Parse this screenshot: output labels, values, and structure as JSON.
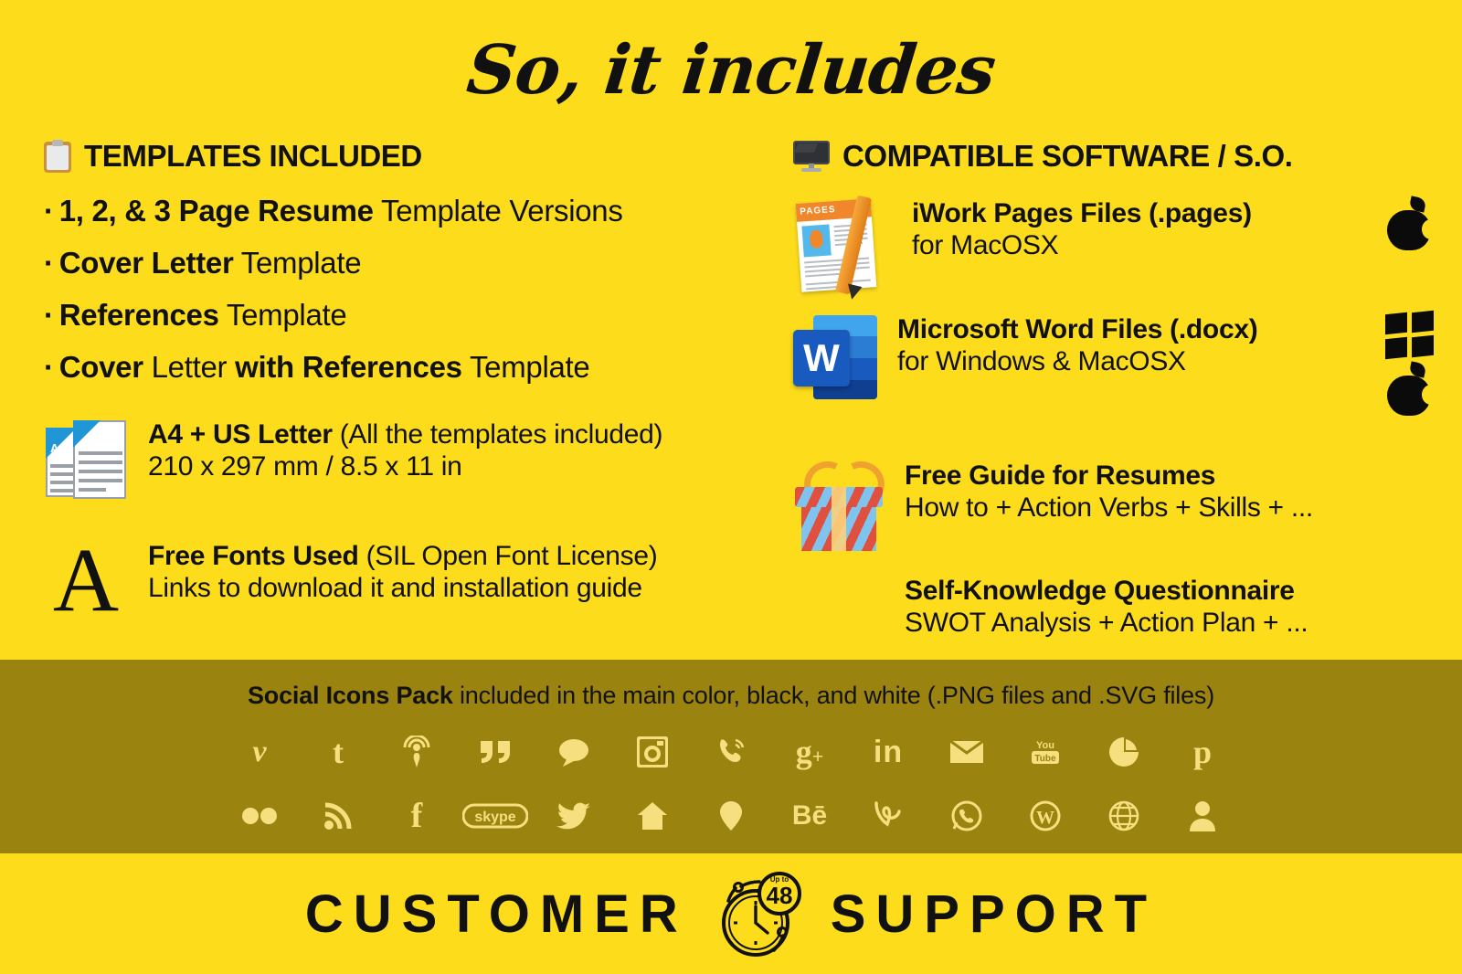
{
  "colors": {
    "background": "#FDDC1C",
    "band": "#9B830F",
    "icon_tint": "#F6DF7E",
    "text": "#111111",
    "word_blue": "#185ABD",
    "pages_orange": "#F0872A"
  },
  "title": "So, it includes",
  "left": {
    "heading": {
      "icon": "clipboard-icon",
      "label": "TEMPLATES INCLUDED"
    },
    "bullets": [
      {
        "marker": "·",
        "bold1": "1, 2, & 3 Page Resume",
        "reg1": " Template Versions",
        "bold2": "",
        "reg2": ""
      },
      {
        "marker": "·",
        "bold1": "Cover Letter",
        "reg1": " Template",
        "bold2": "",
        "reg2": ""
      },
      {
        "marker": "·",
        "bold1": "References",
        "reg1": " Template",
        "bold2": "",
        "reg2": ""
      },
      {
        "marker": "·",
        "bold1": "Cover",
        "reg1": " Letter ",
        "bold2": "with References",
        "reg2": " Template"
      }
    ],
    "features": [
      {
        "icon": "a4-us-letter-documents-icon",
        "icon_label": "A4",
        "line1_bold": "A4 + US Letter",
        "line1_reg": " (All the templates included)",
        "line2": "210 x 297 mm / 8.5 x 11 in"
      },
      {
        "icon": "serif-letter-a-icon",
        "icon_label": "A",
        "line1_bold": "Free Fonts Used",
        "line1_reg": " (SIL Open Font License)",
        "line2": "Links to download it and installation guide"
      }
    ]
  },
  "right": {
    "heading": {
      "icon": "monitor-icon",
      "label": "COMPATIBLE SOFTWARE / S.O."
    },
    "features": [
      {
        "icon": "pages-app-icon",
        "icon_label": "PAGES",
        "line1_bold": "iWork Pages Files (.pages)",
        "line1_reg": "",
        "line2": "for MacOSX",
        "platform_icons": [
          "apple-logo-icon"
        ]
      },
      {
        "icon": "microsoft-word-icon",
        "icon_label": "W",
        "line1_bold": "Microsoft Word Files (.docx)",
        "line1_reg": "",
        "line2": "for Windows & MacOSX",
        "platform_icons": [
          "windows-logo-icon",
          "apple-logo-icon"
        ]
      },
      {
        "icon": "gift-box-icon",
        "icon_label": "",
        "line1_bold": "Free Guide for Resumes",
        "line1_reg": "",
        "line2": "How to + Action Verbs + Skills + ...",
        "platform_icons": []
      },
      {
        "icon": "",
        "icon_label": "",
        "line1_bold": "Self-Knowledge Questionnaire",
        "line1_reg": "",
        "line2": "SWOT Analysis + Action Plan + ...",
        "platform_icons": []
      }
    ]
  },
  "band": {
    "text_bold": "Social Icons Pack",
    "text_reg": " included in the main color, black, and white (.PNG files and .SVG files)",
    "icons_row1": [
      "vimeo-icon",
      "tumblr-icon",
      "podcast-icon",
      "quote-icon",
      "chat-bubble-icon",
      "instagram-icon",
      "viber-phone-icon",
      "google-plus-icon",
      "linkedin-icon",
      "email-icon",
      "youtube-icon",
      "picasa-icon",
      "pinterest-icon"
    ],
    "icons_row2": [
      "flickr-icon",
      "rss-icon",
      "facebook-icon",
      "skype-icon",
      "twitter-icon",
      "home-icon",
      "location-pin-icon",
      "behance-icon",
      "vine-icon",
      "whatsapp-icon",
      "wordpress-icon",
      "globe-icon",
      "person-icon"
    ]
  },
  "bottom": {
    "word1": "CUSTOMER",
    "word2": "SUPPORT",
    "clock_icon": "stopwatch-icon",
    "clock_badge_small": "Up to",
    "clock_badge_number": "48"
  }
}
